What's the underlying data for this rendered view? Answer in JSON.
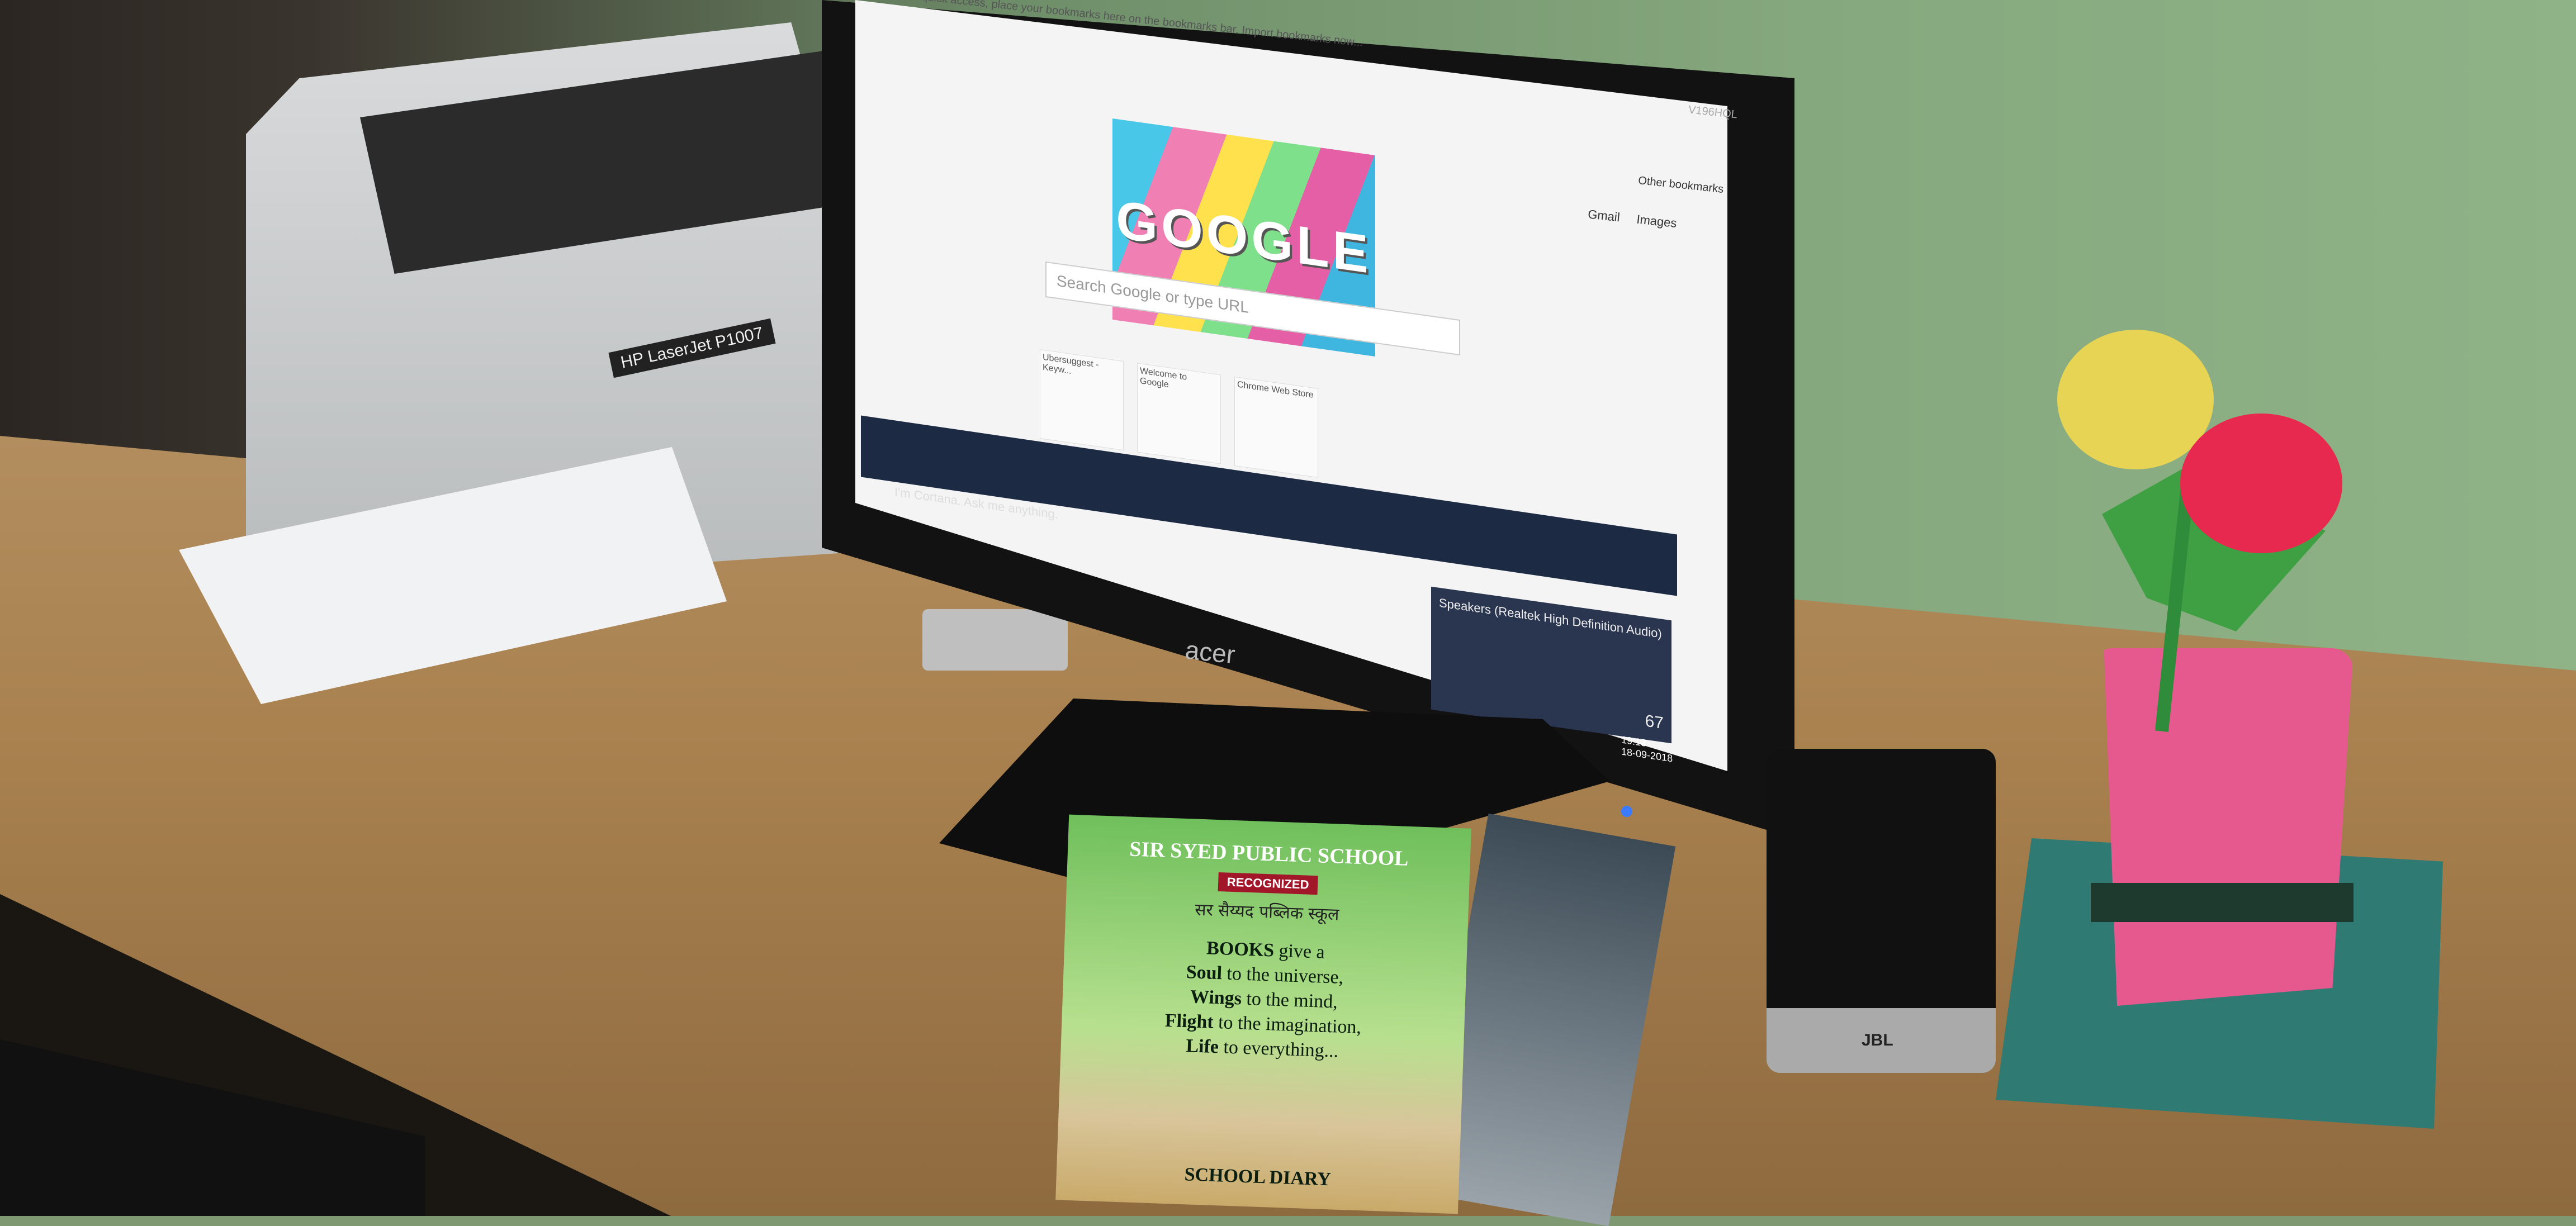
{
  "scene": {
    "description_colors": {
      "wall": "#86a87e",
      "desk": "#a9814f",
      "screen": "#f4f4f4",
      "vase": "#e5598f"
    }
  },
  "browser": {
    "bookmarks_hint": "Apps   For quick access, place your bookmarks here on the bookmarks bar.   Import bookmarks now...",
    "other_bookmarks": "Other bookmarks",
    "top_links": [
      "Gmail",
      "Images"
    ],
    "doodle_text": "GOOGLE",
    "search_placeholder": "Search Google or type URL",
    "tiles": [
      "Ubersuggest - Keyw...",
      "Welcome to Google",
      "Chrome Web Store"
    ]
  },
  "taskbar": {
    "cortana_placeholder": "I'm Cortana. Ask me anything.",
    "time": "19:13",
    "date": "18-09-2018"
  },
  "volume_popup": {
    "title": "Speakers (Realtek High Definition Audio)",
    "level": "67"
  },
  "monitor": {
    "brand": "acer",
    "model": "V196HQL"
  },
  "printer": {
    "label": "HP LaserJet P1007"
  },
  "speaker": {
    "logo": "JBL"
  },
  "book": {
    "school_en": "SIR SYED PUBLIC SCHOOL",
    "recognized": "RECOGNIZED",
    "school_hi": "सर सैय्यद पब्लिक स्कूल",
    "motto_lines": [
      [
        "BOOKS",
        " give a"
      ],
      [
        "Soul",
        " to the universe,"
      ],
      [
        "Wings",
        " to the mind,"
      ],
      [
        "Flight",
        " to the imagination,"
      ],
      [
        "Life",
        " to everything..."
      ]
    ],
    "title": "SCHOOL DIARY"
  }
}
